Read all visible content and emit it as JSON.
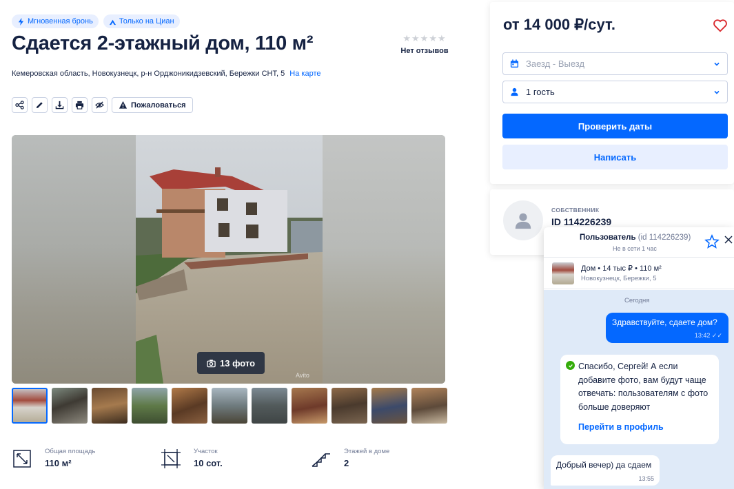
{
  "listing": {
    "badges": [
      "Мгновенная бронь",
      "Только на Циан"
    ],
    "title": "Сдается 2-этажный дом, 110 м²",
    "reviews": {
      "stars_filled": 0,
      "stars_total": 5,
      "label": "Нет отзывов"
    },
    "address": "Кемеровская область, Новокузнецк, р-н Орджоникидзевский, Бережки СНТ, 5",
    "map_link": "На карте",
    "actions": {
      "icons": [
        "share-icon",
        "edit-icon",
        "download-icon",
        "print-icon",
        "hide-icon"
      ],
      "complain": "Пожаловаться"
    },
    "gallery": {
      "photo_count": "13 фото",
      "watermark": "Avito",
      "thumbnails_count": 11
    },
    "features": [
      {
        "label": "Общая площадь",
        "value": "110 м²",
        "icon": "area-icon"
      },
      {
        "label": "Участок",
        "value": "10 сот.",
        "icon": "plot-icon"
      },
      {
        "label": "Этажей в доме",
        "value": "2",
        "icon": "stairs-icon"
      }
    ]
  },
  "booking": {
    "price": "от 14 000 ₽/сут.",
    "dates_placeholder": "Заезд - Выезд",
    "guests": "1 гость",
    "check_button": "Проверить даты",
    "write_button": "Написать"
  },
  "owner": {
    "role": "СОБСТВЕННИК",
    "id": "ID 114226239"
  },
  "chat": {
    "user_name": "Пользователь",
    "user_id": "(id 114226239)",
    "status": "Не в сети 1 час",
    "listing_title": "Дом • 14 тыс ₽ • 110 м²",
    "listing_sub": "Новокузнецк, Бережки, 5",
    "day": "Сегодня",
    "messages": [
      {
        "text": "Здравствуйте, сдаете дом?",
        "time": "13:42"
      },
      {
        "text": "Спасибо, Сергей! А если добавите фото, вам будут чаще отвечать: пользователям с фото больше доверяют",
        "link": "Перейти в профиль"
      },
      {
        "text": "Добрый вечер) да сдаем",
        "time": "13:55"
      }
    ]
  },
  "colors": {
    "accent": "#0468ff",
    "accent_light": "#e8efff",
    "text": "#152242",
    "muted": "#707a95",
    "chat_bg": "#dfeaf8",
    "ok": "#34ac0a",
    "heart": "#d9272c"
  }
}
